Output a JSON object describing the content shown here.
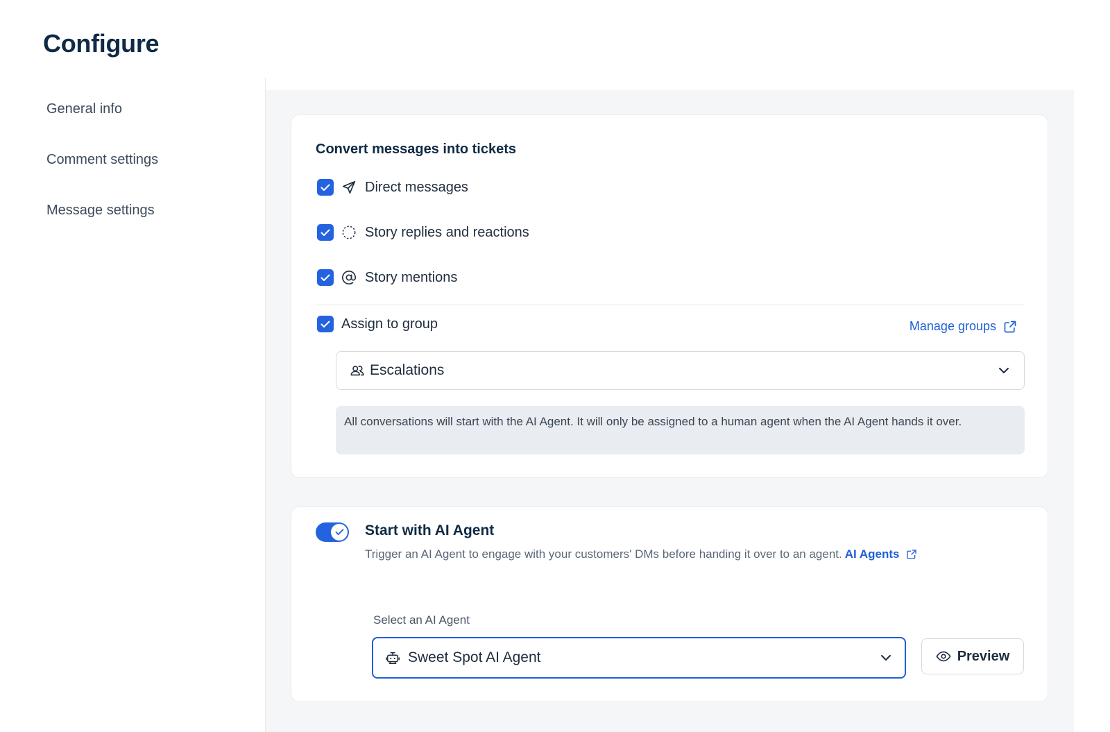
{
  "page": {
    "title": "Configure"
  },
  "sidebar": {
    "items": [
      {
        "label": "General info"
      },
      {
        "label": "Comment settings"
      },
      {
        "label": "Message settings"
      }
    ]
  },
  "convert": {
    "title": "Convert messages into tickets",
    "options": [
      {
        "label": "Direct messages",
        "checked": true,
        "icon": "send-icon"
      },
      {
        "label": "Story replies and reactions",
        "checked": true,
        "icon": "dashed-circle-icon"
      },
      {
        "label": "Story mentions",
        "checked": true,
        "icon": "at-sign-icon"
      }
    ],
    "assign": {
      "label": "Assign to group",
      "checked": true
    },
    "manage_groups_label": "Manage groups",
    "group_select": {
      "value": "Escalations",
      "icon": "group-icon"
    },
    "info": "All conversations will start with the AI Agent. It will only be assigned to a human agent when the AI Agent hands it over."
  },
  "ai_agent": {
    "enabled": true,
    "title": "Start with AI Agent",
    "description": "Trigger an AI Agent to engage with your customers' DMs before handing it over to an agent.",
    "link_label": "AI Agents",
    "select_label": "Select an AI Agent",
    "select_value": "Sweet Spot AI Agent",
    "preview_label": "Preview"
  },
  "colors": {
    "accent": "#2463e0",
    "link": "#1f5fd6",
    "title": "#0f2a44",
    "panel_bg": "#f5f6f8"
  }
}
